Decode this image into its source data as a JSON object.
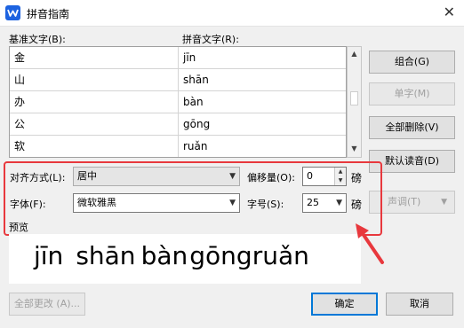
{
  "window": {
    "title": "拼音指南",
    "close_glyph": "✕"
  },
  "labels": {
    "base_text": "基准文字(B):",
    "pinyin_text": "拼音文字(R):",
    "preview": "预览"
  },
  "rows": [
    {
      "base": "金",
      "pinyin": "jīn"
    },
    {
      "base": "山",
      "pinyin": "shān"
    },
    {
      "base": "办",
      "pinyin": "bàn"
    },
    {
      "base": "公",
      "pinyin": "gōng"
    },
    {
      "base": "软",
      "pinyin": "ruǎn"
    }
  ],
  "buttons": {
    "combine": "组合(G)",
    "single": "单字(M)",
    "delete_all": "全部删除(V)",
    "default_reading": "默认读音(D)",
    "tone": "声调(T)",
    "change_all": "全部更改 (A)...",
    "ok": "确定",
    "cancel": "取消"
  },
  "alignment": {
    "label": "对齐方式(L):",
    "value": "居中"
  },
  "offset": {
    "label": "偏移量(O):",
    "value": "0",
    "unit": "磅"
  },
  "font": {
    "label": "字体(F):",
    "value": "微软雅黑"
  },
  "size": {
    "label": "字号(S):",
    "value": "25",
    "unit": "磅"
  },
  "preview_syllables": [
    "jīn",
    "shān",
    "bàn",
    "gōng",
    "ruǎn"
  ],
  "colors": {
    "highlight": "#e8383d",
    "accent": "#0078d7",
    "app_icon": "#1d63e0"
  }
}
